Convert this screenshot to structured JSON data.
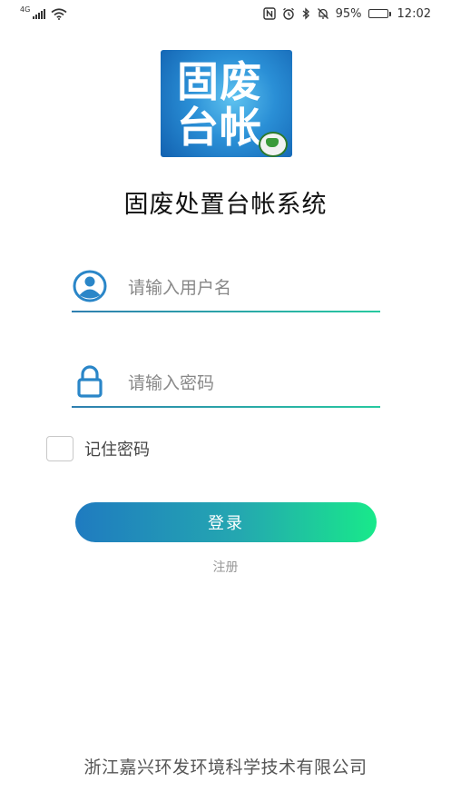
{
  "status_bar": {
    "network": "4G",
    "battery": "95%",
    "battery_level": 0.95,
    "time": "12:02",
    "icons": [
      "signal-icon",
      "wifi-icon",
      "nfc-icon",
      "alarm-icon",
      "bluetooth-icon",
      "mute-icon",
      "battery-icon"
    ]
  },
  "logo": {
    "line1": "固废",
    "line2": "台帐",
    "colors": {
      "primary": "#2a8fd6",
      "dark": "#1261b0",
      "badge": "#3a9a3a"
    }
  },
  "app_title": "固废处置台帐系统",
  "username": {
    "placeholder": "请输入用户名",
    "value": "",
    "icon": "user-icon"
  },
  "password": {
    "placeholder": "请输入密码",
    "value": "",
    "icon": "lock-icon"
  },
  "remember": {
    "label": "记住密码",
    "checked": false
  },
  "login_button": {
    "label": "登录",
    "gradient": [
      "#1f7bc0",
      "#18e98a"
    ]
  },
  "register_link": "注册",
  "footer": "浙江嘉兴环发环境科学技术有限公司",
  "colors": {
    "accent": "#2a86c8",
    "underline_start": "#2f7fb0",
    "underline_end": "#27c9a0"
  }
}
